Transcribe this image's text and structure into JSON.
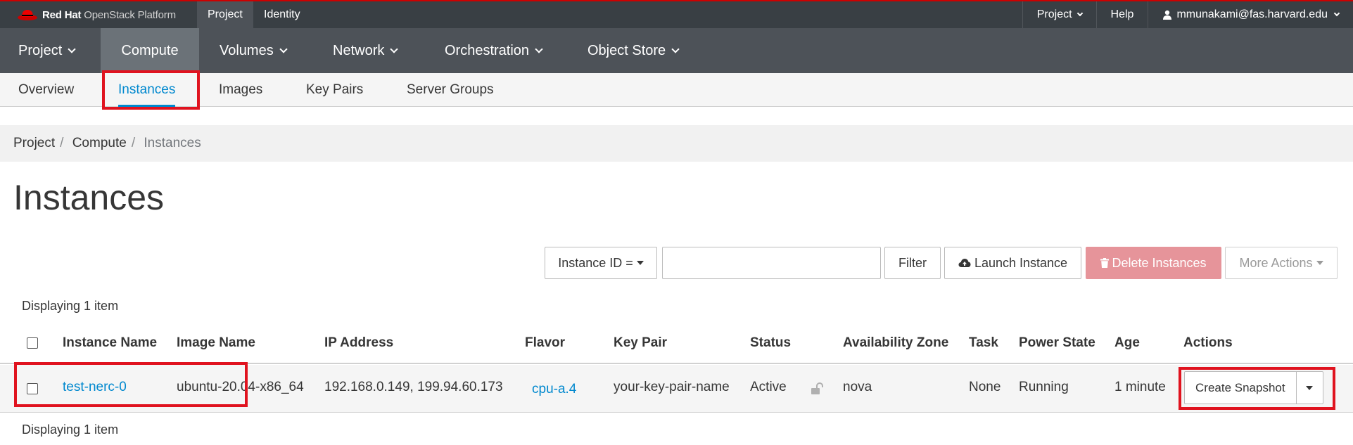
{
  "brand": {
    "name_bold": "Red Hat",
    "name_light": "OpenStack Platform"
  },
  "top_tabs": [
    {
      "label": "Project"
    },
    {
      "label": "Identity"
    }
  ],
  "top_right": {
    "project": "Project",
    "help": "Help",
    "user": "mmunakami@fas.harvard.edu"
  },
  "main_nav": [
    {
      "label": "Project"
    },
    {
      "label": "Compute"
    },
    {
      "label": "Volumes"
    },
    {
      "label": "Network"
    },
    {
      "label": "Orchestration"
    },
    {
      "label": "Object Store"
    }
  ],
  "sub_nav": [
    {
      "label": "Overview"
    },
    {
      "label": "Instances"
    },
    {
      "label": "Images"
    },
    {
      "label": "Key Pairs"
    },
    {
      "label": "Server Groups"
    }
  ],
  "breadcrumb": {
    "items": [
      "Project",
      "Compute"
    ],
    "current": "Instances"
  },
  "page_title": "Instances",
  "toolbar": {
    "filter_field": "Instance ID =",
    "filter_value": "",
    "filter_button": "Filter",
    "launch": "Launch Instance",
    "delete": "Delete Instances",
    "more": "More Actions"
  },
  "display_count": "Displaying 1 item",
  "table": {
    "headers": [
      "Instance Name",
      "Image Name",
      "IP Address",
      "Flavor",
      "Key Pair",
      "Status",
      "Availability Zone",
      "Task",
      "Power State",
      "Age",
      "Actions"
    ],
    "row": {
      "name": "test-nerc-0",
      "image": "ubuntu-20.04-x86_64",
      "ip": "192.168.0.149, 199.94.60.173",
      "flavor": "cpu-a.4",
      "key_pair": "your-key-pair-name",
      "status": "Active",
      "zone": "nova",
      "task": "None",
      "power": "Running",
      "age": "1 minute",
      "action": "Create Snapshot"
    }
  },
  "colors": {
    "accent": "#0088ce",
    "danger": "#e6949a",
    "highlight": "#e0131f",
    "nav_bg": "#4d5258",
    "topbar_bg": "#393f44"
  }
}
